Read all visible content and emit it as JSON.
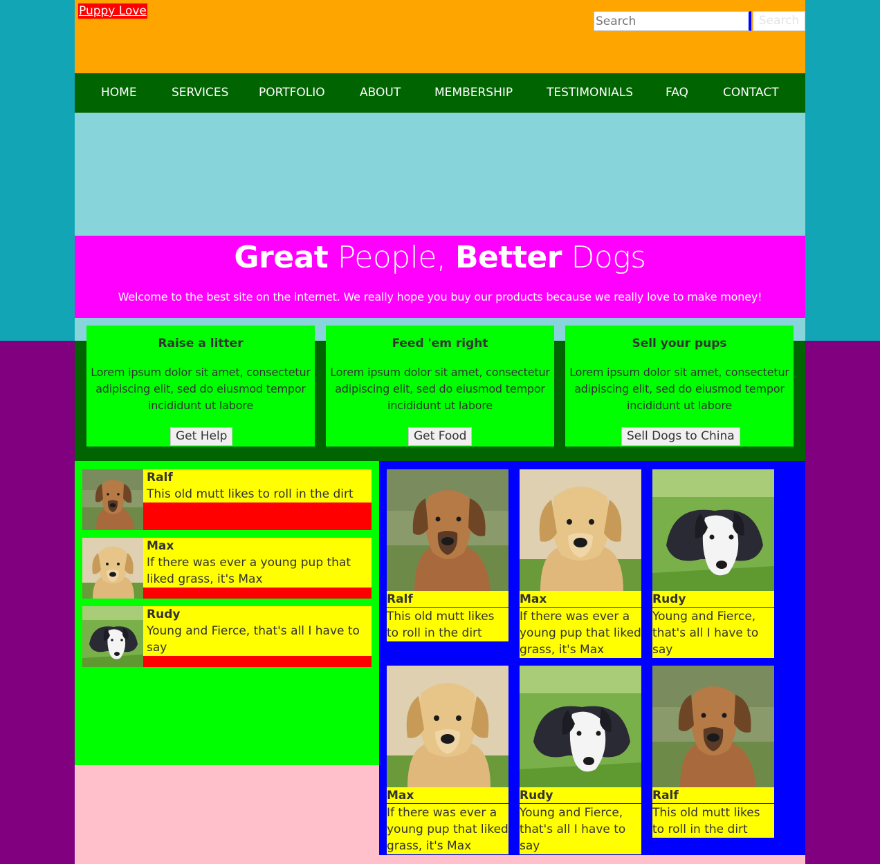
{
  "header": {
    "logo": "Puppy Love",
    "search_placeholder": "Search",
    "search_button": "Search"
  },
  "nav": {
    "items": [
      "HOME",
      "SERVICES",
      "PORTFOLIO",
      "ABOUT",
      "MEMBERSHIP",
      "TESTIMONIALS",
      "FAQ",
      "CONTACT"
    ]
  },
  "hero": {
    "title_bold_1": "Great",
    "title_light_1": " People, ",
    "title_bold_2": "Better",
    "title_light_2": " Dogs",
    "text": "Welcome to the best site on the internet. We really hope you buy our products because we really love to make money!"
  },
  "features": [
    {
      "title": "Raise a litter",
      "text": "Lorem ipsum dolor sit amet, consectetur adipiscing elit, sed do eiusmod tempor incididunt ut labore",
      "button": "Get Help"
    },
    {
      "title": "Feed 'em right",
      "text": "Lorem ipsum dolor sit amet, consectetur adipiscing elit, sed do eiusmod tempor incididunt ut labore",
      "button": "Get Food"
    },
    {
      "title": "Sell your pups",
      "text": "Lorem ipsum dolor sit amet, consectetur adipiscing elit, sed do eiusmod tempor incididunt ut labore",
      "button": "Sell Dogs to China"
    }
  ],
  "dog_list": [
    {
      "name": "Ralf",
      "desc": "This old mutt likes to roll in the dirt",
      "photo": "brown-hound-photo"
    },
    {
      "name": "Max",
      "desc": "If there was ever a young pup that liked grass, it's Max",
      "photo": "golden-puppy-photo"
    },
    {
      "name": "Rudy",
      "desc": "Young and Fierce, that's all I have to say",
      "photo": "black-white-puppy-photo"
    }
  ],
  "dog_grid": [
    {
      "name": "Ralf",
      "desc": "This old mutt likes to roll in the dirt",
      "photo": "brown-hound-photo"
    },
    {
      "name": "Max",
      "desc": "If there was ever a young pup that liked grass, it's Max",
      "photo": "golden-puppy-photo"
    },
    {
      "name": "Rudy",
      "desc": "Young and Fierce, that's all I have to say",
      "photo": "black-white-puppy-photo"
    },
    {
      "name": "Max",
      "desc": "If there was ever a young pup that liked grass, it's Max",
      "photo": "golden-puppy-photo"
    },
    {
      "name": "Rudy",
      "desc": "Young and Fierce, that's all I have to say",
      "photo": "black-white-puppy-photo"
    },
    {
      "name": "Ralf",
      "desc": "This old mutt likes to roll in the dirt",
      "photo": "brown-hound-photo"
    }
  ],
  "colors": {
    "header": "#ffa500",
    "nav": "#006400",
    "banner": "#87d4db",
    "hero": "#ff00ff",
    "card": "#00ff00",
    "grid": "#0000ff",
    "caption": "#ffff00",
    "accent": "#ff0000"
  }
}
